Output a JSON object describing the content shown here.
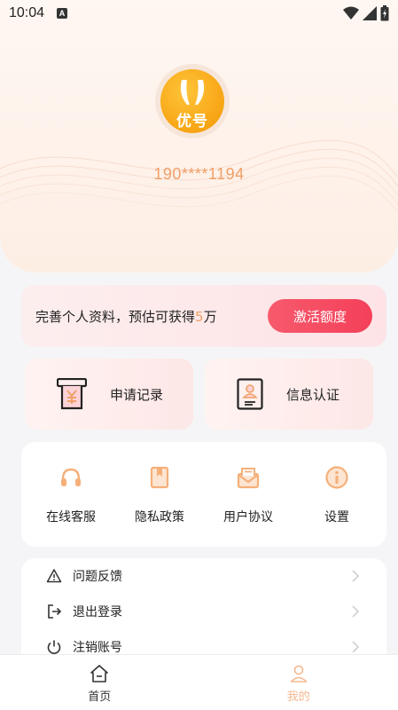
{
  "status_bar": {
    "time": "10:04",
    "badge": "A"
  },
  "profile": {
    "logo_text": "优号",
    "phone": "190****1194"
  },
  "promo": {
    "text_before": "完善个人资料，预估可获得",
    "highlight": "5",
    "text_after": "万",
    "button_label": "激活额度"
  },
  "cards": {
    "records_label": "申请记录",
    "verify_label": "信息认证"
  },
  "services": [
    {
      "label": "在线客服",
      "icon": "headset-icon"
    },
    {
      "label": "隐私政策",
      "icon": "bookmark-book-icon"
    },
    {
      "label": "用户协议",
      "icon": "envelope-icon"
    },
    {
      "label": "设置",
      "icon": "info-icon"
    }
  ],
  "menu": [
    {
      "label": "问题反馈",
      "icon": "warning-icon"
    },
    {
      "label": "退出登录",
      "icon": "logout-icon"
    },
    {
      "label": "注销账号",
      "icon": "power-icon"
    }
  ],
  "bottom_nav": {
    "home_label": "首页",
    "mine_label": "我的"
  },
  "colors": {
    "accent": "#f0a067",
    "button": "#f4405a",
    "logo": "#f7a514"
  }
}
